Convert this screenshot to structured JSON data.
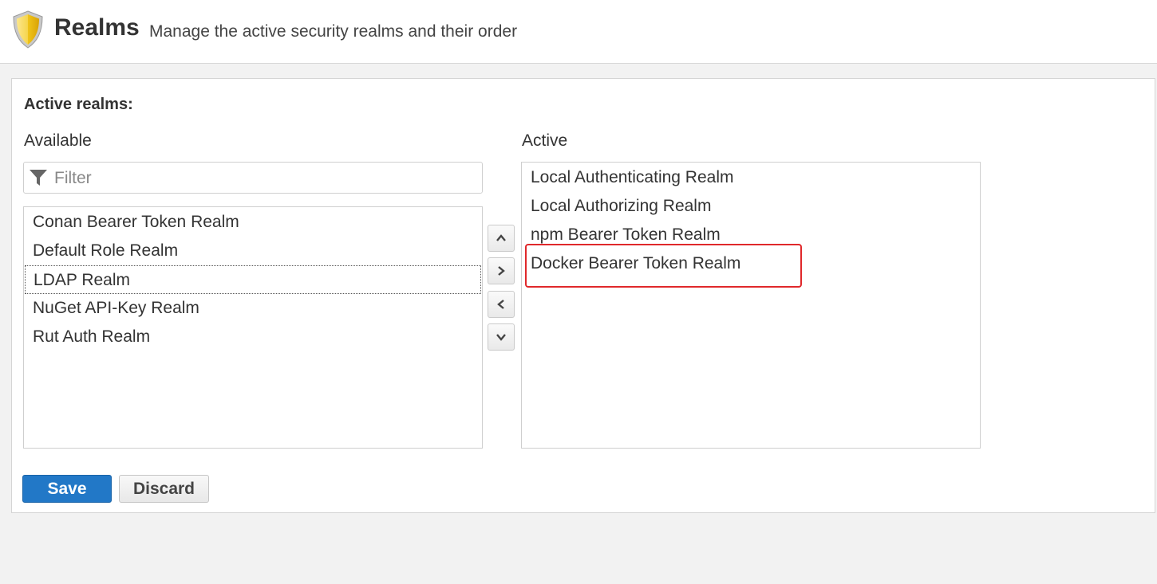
{
  "header": {
    "title": "Realms",
    "subtitle": "Manage the active security realms and their order"
  },
  "section": {
    "title": "Active realms:"
  },
  "available": {
    "label": "Available",
    "filter_placeholder": "Filter",
    "filter_value": "",
    "items": [
      {
        "label": "Conan Bearer Token Realm"
      },
      {
        "label": "Default Role Realm"
      },
      {
        "label": "LDAP Realm"
      },
      {
        "label": "NuGet API-Key Realm"
      },
      {
        "label": "Rut Auth Realm"
      }
    ]
  },
  "active": {
    "label": "Active",
    "items": [
      {
        "label": "Local Authenticating Realm"
      },
      {
        "label": "Local Authorizing Realm"
      },
      {
        "label": "npm Bearer Token Realm"
      },
      {
        "label": "Docker Bearer Token Realm"
      }
    ]
  },
  "buttons": {
    "save": "Save",
    "discard": "Discard"
  },
  "colors": {
    "accent": "#2278c7",
    "highlight": "#e0282b",
    "shield": "#f0c419"
  },
  "icons": {
    "header": "shield-icon",
    "filter": "filter-icon",
    "move_up": "chevron-up-icon",
    "move_right": "chevron-right-icon",
    "move_left": "chevron-left-icon",
    "move_down": "chevron-down-icon"
  }
}
